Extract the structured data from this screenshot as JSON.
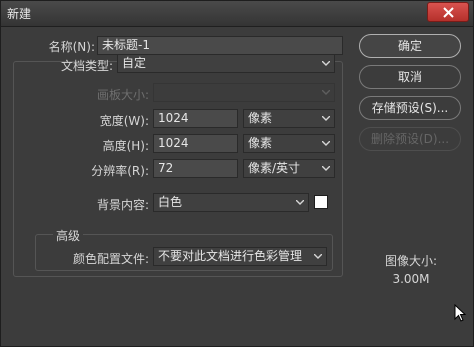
{
  "window": {
    "title": "新建"
  },
  "form": {
    "name": {
      "label": "名称(N):",
      "value": "未标题-1"
    },
    "doc_type": {
      "label": "文档类型:",
      "value": "自定"
    },
    "artboard_size": {
      "label": "画板大小:",
      "value": ""
    },
    "width": {
      "label": "宽度(W):",
      "value": "1024",
      "unit": "像素"
    },
    "height": {
      "label": "高度(H):",
      "value": "1024",
      "unit": "像素"
    },
    "resolution": {
      "label": "分辨率(R):",
      "value": "72",
      "unit": "像素/英寸"
    },
    "background": {
      "label": "背景内容:",
      "value": "白色",
      "swatch_color": "#ffffff"
    }
  },
  "advanced": {
    "title": "高级",
    "color_profile": {
      "label": "颜色配置文件:",
      "value": "不要对此文档进行色彩管理"
    }
  },
  "buttons": {
    "ok": "确定",
    "cancel": "取消",
    "save_preset": "存储预设(S)...",
    "delete_preset": "删除预设(D)..."
  },
  "image_size": {
    "label": "图像大小:",
    "value": "3.00M"
  }
}
